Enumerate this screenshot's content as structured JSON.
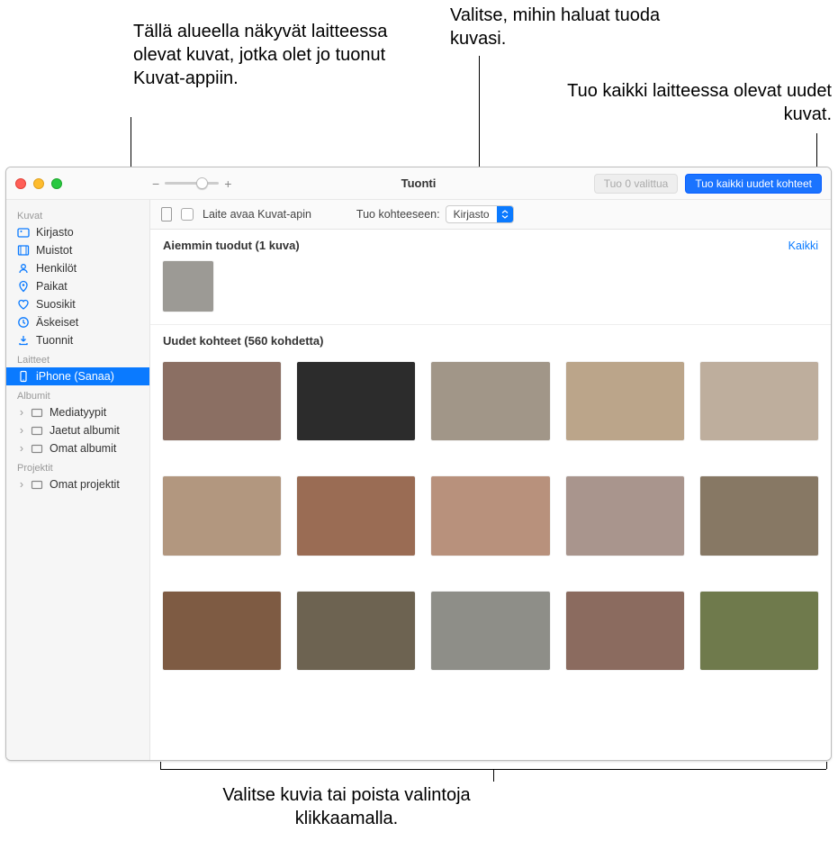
{
  "callouts": {
    "imported_area": "Tällä alueella näkyvät laitteessa olevat kuvat, jotka olet jo tuonut Kuvat-appiin.",
    "choose_dest": "Valitse, mihin haluat tuoda kuvasi.",
    "import_all": "Tuo kaikki laitteessa olevat uudet kuvat.",
    "select_photos": "Valitse kuvia tai poista valintoja klikkaamalla."
  },
  "window": {
    "title": "Tuonti",
    "buttons": {
      "import_selected": "Tuo 0 valittua",
      "import_all_new": "Tuo kaikki uudet kohteet"
    }
  },
  "sidebar": {
    "sections": {
      "photos": "Kuvat",
      "devices": "Laitteet",
      "albums": "Albumit",
      "projects": "Projektit"
    },
    "items": {
      "library": "Kirjasto",
      "memories": "Muistot",
      "people": "Henkilöt",
      "places": "Paikat",
      "favorites": "Suosikit",
      "recents": "Äskeiset",
      "imports": "Tuonnit",
      "device": "iPhone (Sanaa)",
      "media_types": "Mediatyypit",
      "shared_albums": "Jaetut albumit",
      "my_albums": "Omat albumit",
      "my_projects": "Omat projektit"
    }
  },
  "import_bar": {
    "open_app_label": "Laite avaa Kuvat-apin",
    "dest_label": "Tuo kohteeseen:",
    "dest_value": "Kirjasto"
  },
  "sections": {
    "previously_imported": "Aiemmin tuodut (1 kuva)",
    "all_link": "Kaikki",
    "new_items": "Uudet kohteet (560 kohdetta)"
  }
}
